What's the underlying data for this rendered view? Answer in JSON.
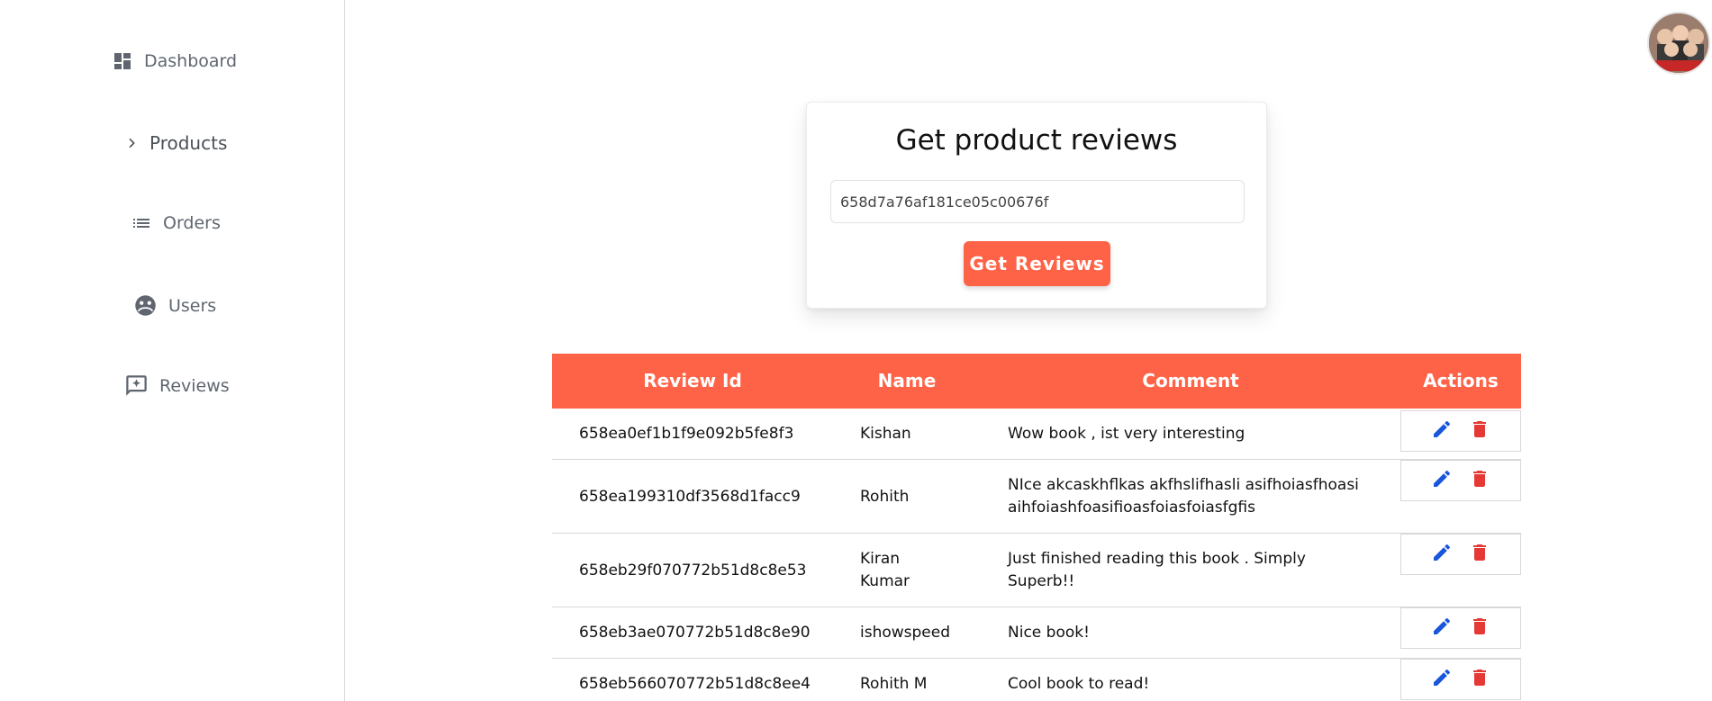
{
  "sidebar": {
    "items": [
      {
        "label": "Dashboard",
        "icon": "dashboard-icon"
      },
      {
        "label": "Products",
        "icon": "chevron-right-icon"
      },
      {
        "label": "Orders",
        "icon": "list-icon"
      },
      {
        "label": "Users",
        "icon": "users-icon"
      },
      {
        "label": "Reviews",
        "icon": "reviews-icon"
      }
    ]
  },
  "card": {
    "title": "Get product reviews",
    "input_value": "658d7a76af181ce05c00676f",
    "button_label": "Get Reviews"
  },
  "table": {
    "headers": [
      "Review Id",
      "Name",
      "Comment",
      "Actions"
    ],
    "rows": [
      {
        "id": "658ea0ef1b1f9e092b5fe8f3",
        "name": "Kishan",
        "comment": "Wow book , ist very interesting"
      },
      {
        "id": "658ea199310df3568d1facc9",
        "name": "Rohith",
        "comment": "NIce akcaskhflkas akfhslifhasli asifhoiasfhoasi aihfoiashfoasifioasfoiasfoiasfgfis"
      },
      {
        "id": "658eb29f070772b51d8c8e53",
        "name": "Kiran Kumar",
        "comment": "Just finished reading this book . Simply Superb!!"
      },
      {
        "id": "658eb3ae070772b51d8c8e90",
        "name": "ishowspeed",
        "comment": "Nice book!"
      },
      {
        "id": "658eb566070772b51d8c8ee4",
        "name": "Rohith M",
        "comment": "Cool book to read!"
      }
    ]
  },
  "colors": {
    "accent": "#ff6347",
    "edit": "#1a56db",
    "delete": "#e53935",
    "nav_text": "#5f6670"
  }
}
